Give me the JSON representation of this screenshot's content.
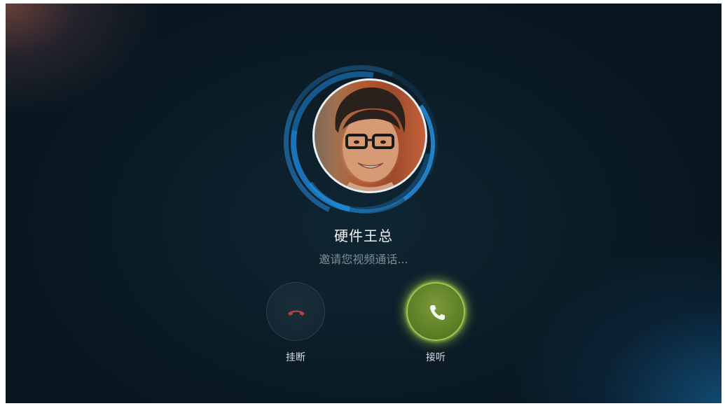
{
  "call": {
    "caller_name": "硬件王总",
    "status": "邀请您视频通话...",
    "decline_label": "挂断",
    "accept_label": "接听"
  },
  "icons": {
    "decline": "phone-hangup-icon",
    "accept": "phone-icon"
  },
  "colors": {
    "ring_accent": "#1e82d2",
    "accept_button": "#5f7f27",
    "accept_glow": "#afdc46",
    "decline_icon": "#b5403a",
    "accept_icon": "#f4f8ee"
  }
}
